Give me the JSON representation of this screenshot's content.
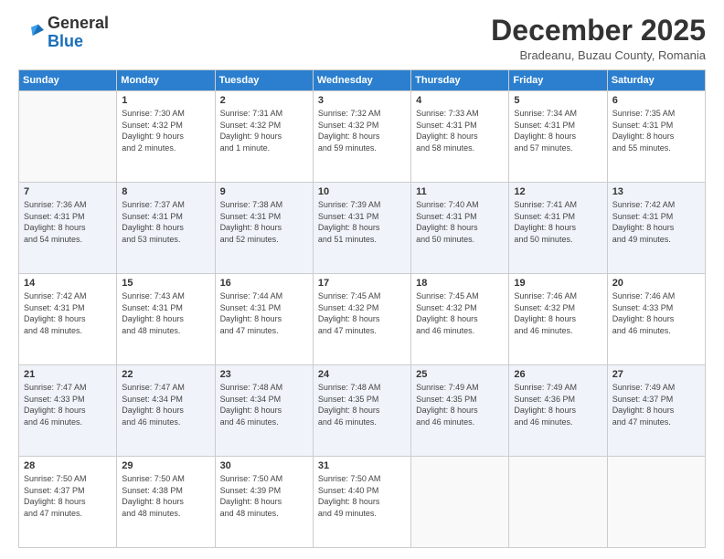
{
  "header": {
    "logo_general": "General",
    "logo_blue": "Blue",
    "month_title": "December 2025",
    "location": "Bradeanu, Buzau County, Romania"
  },
  "days_of_week": [
    "Sunday",
    "Monday",
    "Tuesday",
    "Wednesday",
    "Thursday",
    "Friday",
    "Saturday"
  ],
  "weeks": [
    [
      {
        "day": "",
        "content": ""
      },
      {
        "day": "1",
        "content": "Sunrise: 7:30 AM\nSunset: 4:32 PM\nDaylight: 9 hours\nand 2 minutes."
      },
      {
        "day": "2",
        "content": "Sunrise: 7:31 AM\nSunset: 4:32 PM\nDaylight: 9 hours\nand 1 minute."
      },
      {
        "day": "3",
        "content": "Sunrise: 7:32 AM\nSunset: 4:32 PM\nDaylight: 8 hours\nand 59 minutes."
      },
      {
        "day": "4",
        "content": "Sunrise: 7:33 AM\nSunset: 4:31 PM\nDaylight: 8 hours\nand 58 minutes."
      },
      {
        "day": "5",
        "content": "Sunrise: 7:34 AM\nSunset: 4:31 PM\nDaylight: 8 hours\nand 57 minutes."
      },
      {
        "day": "6",
        "content": "Sunrise: 7:35 AM\nSunset: 4:31 PM\nDaylight: 8 hours\nand 55 minutes."
      }
    ],
    [
      {
        "day": "7",
        "content": "Sunrise: 7:36 AM\nSunset: 4:31 PM\nDaylight: 8 hours\nand 54 minutes."
      },
      {
        "day": "8",
        "content": "Sunrise: 7:37 AM\nSunset: 4:31 PM\nDaylight: 8 hours\nand 53 minutes."
      },
      {
        "day": "9",
        "content": "Sunrise: 7:38 AM\nSunset: 4:31 PM\nDaylight: 8 hours\nand 52 minutes."
      },
      {
        "day": "10",
        "content": "Sunrise: 7:39 AM\nSunset: 4:31 PM\nDaylight: 8 hours\nand 51 minutes."
      },
      {
        "day": "11",
        "content": "Sunrise: 7:40 AM\nSunset: 4:31 PM\nDaylight: 8 hours\nand 50 minutes."
      },
      {
        "day": "12",
        "content": "Sunrise: 7:41 AM\nSunset: 4:31 PM\nDaylight: 8 hours\nand 50 minutes."
      },
      {
        "day": "13",
        "content": "Sunrise: 7:42 AM\nSunset: 4:31 PM\nDaylight: 8 hours\nand 49 minutes."
      }
    ],
    [
      {
        "day": "14",
        "content": "Sunrise: 7:42 AM\nSunset: 4:31 PM\nDaylight: 8 hours\nand 48 minutes."
      },
      {
        "day": "15",
        "content": "Sunrise: 7:43 AM\nSunset: 4:31 PM\nDaylight: 8 hours\nand 48 minutes."
      },
      {
        "day": "16",
        "content": "Sunrise: 7:44 AM\nSunset: 4:31 PM\nDaylight: 8 hours\nand 47 minutes."
      },
      {
        "day": "17",
        "content": "Sunrise: 7:45 AM\nSunset: 4:32 PM\nDaylight: 8 hours\nand 47 minutes."
      },
      {
        "day": "18",
        "content": "Sunrise: 7:45 AM\nSunset: 4:32 PM\nDaylight: 8 hours\nand 46 minutes."
      },
      {
        "day": "19",
        "content": "Sunrise: 7:46 AM\nSunset: 4:32 PM\nDaylight: 8 hours\nand 46 minutes."
      },
      {
        "day": "20",
        "content": "Sunrise: 7:46 AM\nSunset: 4:33 PM\nDaylight: 8 hours\nand 46 minutes."
      }
    ],
    [
      {
        "day": "21",
        "content": "Sunrise: 7:47 AM\nSunset: 4:33 PM\nDaylight: 8 hours\nand 46 minutes."
      },
      {
        "day": "22",
        "content": "Sunrise: 7:47 AM\nSunset: 4:34 PM\nDaylight: 8 hours\nand 46 minutes."
      },
      {
        "day": "23",
        "content": "Sunrise: 7:48 AM\nSunset: 4:34 PM\nDaylight: 8 hours\nand 46 minutes."
      },
      {
        "day": "24",
        "content": "Sunrise: 7:48 AM\nSunset: 4:35 PM\nDaylight: 8 hours\nand 46 minutes."
      },
      {
        "day": "25",
        "content": "Sunrise: 7:49 AM\nSunset: 4:35 PM\nDaylight: 8 hours\nand 46 minutes."
      },
      {
        "day": "26",
        "content": "Sunrise: 7:49 AM\nSunset: 4:36 PM\nDaylight: 8 hours\nand 46 minutes."
      },
      {
        "day": "27",
        "content": "Sunrise: 7:49 AM\nSunset: 4:37 PM\nDaylight: 8 hours\nand 47 minutes."
      }
    ],
    [
      {
        "day": "28",
        "content": "Sunrise: 7:50 AM\nSunset: 4:37 PM\nDaylight: 8 hours\nand 47 minutes."
      },
      {
        "day": "29",
        "content": "Sunrise: 7:50 AM\nSunset: 4:38 PM\nDaylight: 8 hours\nand 48 minutes."
      },
      {
        "day": "30",
        "content": "Sunrise: 7:50 AM\nSunset: 4:39 PM\nDaylight: 8 hours\nand 48 minutes."
      },
      {
        "day": "31",
        "content": "Sunrise: 7:50 AM\nSunset: 4:40 PM\nDaylight: 8 hours\nand 49 minutes."
      },
      {
        "day": "",
        "content": ""
      },
      {
        "day": "",
        "content": ""
      },
      {
        "day": "",
        "content": ""
      }
    ]
  ]
}
